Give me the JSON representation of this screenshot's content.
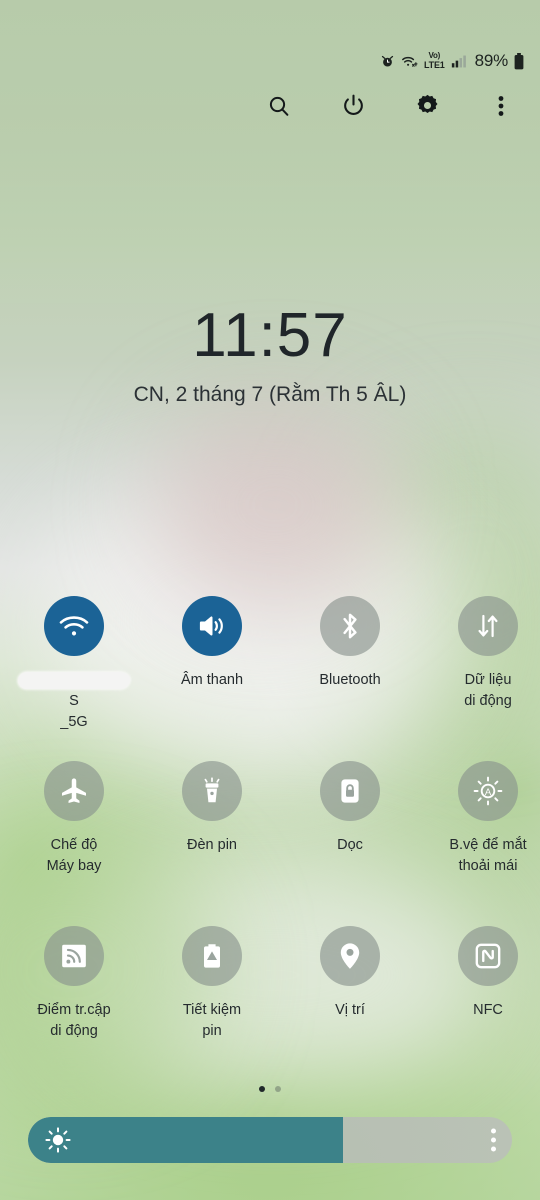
{
  "statusbar": {
    "alarm_icon": "alarm-icon",
    "wifi_icon": "wifi-status-icon",
    "volte": {
      "line1": "Vo)",
      "line2": "LTE1"
    },
    "signal_icon": "signal-bars-icon",
    "battery_percent": "89%",
    "battery_icon": "battery-icon"
  },
  "toolbar": {
    "search": "search-icon",
    "power": "power-icon",
    "settings": "gear-icon",
    "more": "overflow-menu-icon"
  },
  "clock": {
    "time": "11:57",
    "date": "CN, 2 tháng 7 (Rằm Th 5 ÂL)"
  },
  "tiles": {
    "rows": [
      [
        {
          "label": "S\n_5G",
          "icon": "wifi-icon",
          "state": "on",
          "redacted": true
        },
        {
          "label": "Âm thanh",
          "icon": "volume-icon",
          "state": "on",
          "redacted": false
        },
        {
          "label": "Bluetooth",
          "icon": "bluetooth-icon",
          "state": "off",
          "redacted": false
        },
        {
          "label": "Dữ liệu\ndi động",
          "icon": "mobile-data-icon",
          "state": "off",
          "redacted": false
        }
      ],
      [
        {
          "label": "Chế độ\nMáy bay",
          "icon": "airplane-icon",
          "state": "off",
          "redacted": false
        },
        {
          "label": "Đèn pin",
          "icon": "flashlight-icon",
          "state": "off",
          "redacted": false
        },
        {
          "label": "Dọc",
          "icon": "rotation-lock-icon",
          "state": "off",
          "redacted": false
        },
        {
          "label": "B.vệ để mắt\nthoải mái",
          "icon": "eye-comfort-icon",
          "state": "off",
          "redacted": false
        }
      ],
      [
        {
          "label": "Điểm tr.cập\ndi động",
          "icon": "hotspot-icon",
          "state": "off",
          "redacted": false
        },
        {
          "label": "Tiết kiệm\npin",
          "icon": "power-saving-icon",
          "state": "off",
          "redacted": false
        },
        {
          "label": "Vị trí",
          "icon": "location-pin-icon",
          "state": "off",
          "redacted": false
        },
        {
          "label": "NFC",
          "icon": "nfc-icon",
          "state": "off",
          "redacted": false
        }
      ]
    ]
  },
  "pager": {
    "count": 2,
    "active_index": 0
  },
  "brightness": {
    "value_percent": 65,
    "sun_icon": "brightness-sun-icon",
    "menu_icon": "brightness-options-icon"
  },
  "colors": {
    "tile_on": "#1b6396",
    "tile_off": "rgba(135,145,140,0.62)",
    "slider_fill": "#3c8289",
    "text": "#252b2e"
  }
}
